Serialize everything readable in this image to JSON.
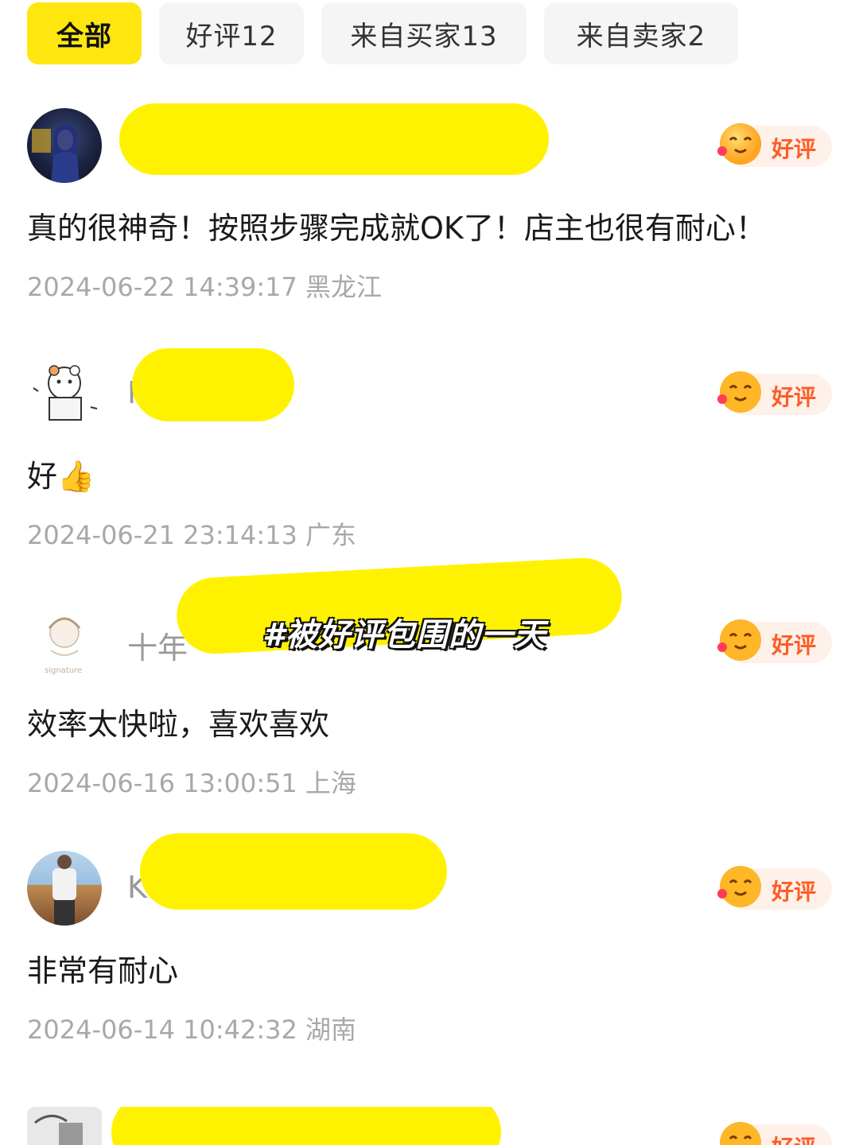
{
  "tabs": [
    {
      "label": "全部",
      "active": true
    },
    {
      "label": "好评12",
      "active": false
    },
    {
      "label": "来自买家13",
      "active": false
    },
    {
      "label": "来自卖家2",
      "active": false
    }
  ],
  "badge_label": "好评",
  "reviews": [
    {
      "name_visible": "",
      "content": "真的很神奇！按照步骤完成就OK了！店主也很有耐心！",
      "timestamp": "2024-06-22 14:39:17",
      "location": "黑龙江"
    },
    {
      "name_visible": "I",
      "content": "好👍",
      "timestamp": "2024-06-21 23:14:13",
      "location": "广东"
    },
    {
      "name_visible": "十年",
      "content": "效率太快啦，喜欢喜欢",
      "timestamp": "2024-06-16 13:00:51",
      "location": "上海"
    },
    {
      "name_visible": "K",
      "content": "非常有耐心",
      "timestamp": "2024-06-14 10:42:32",
      "location": "湖南"
    },
    {
      "name_visible": "",
      "content": "",
      "timestamp": "",
      "location": ""
    }
  ],
  "overlay_text": "#被好评包围的一天",
  "colors": {
    "accent_yellow": "#ffe60f",
    "badge_orange": "#ff5c26",
    "meta_gray": "#a8a8a8"
  }
}
